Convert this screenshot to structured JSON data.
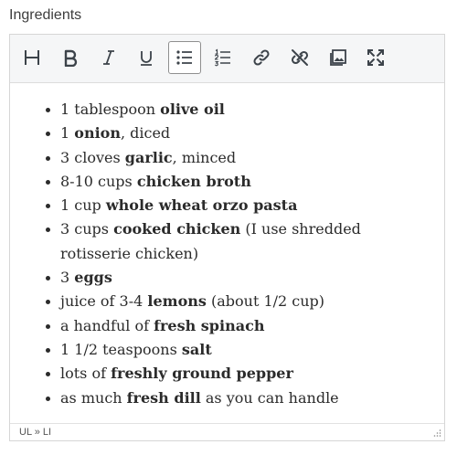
{
  "field": {
    "label": "Ingredients"
  },
  "toolbar": {
    "buttons": [
      {
        "name": "heading",
        "icon": "heading-icon",
        "active": false
      },
      {
        "name": "bold",
        "icon": "bold-icon",
        "active": false
      },
      {
        "name": "italic",
        "icon": "italic-icon",
        "active": false
      },
      {
        "name": "underline",
        "icon": "underline-icon",
        "active": false
      },
      {
        "name": "bulleted-list",
        "icon": "bulleted-list-icon",
        "active": true
      },
      {
        "name": "numbered-list",
        "icon": "numbered-list-icon",
        "active": false
      },
      {
        "name": "link",
        "icon": "link-icon",
        "active": false
      },
      {
        "name": "unlink",
        "icon": "unlink-icon",
        "active": false
      },
      {
        "name": "image",
        "icon": "image-icon",
        "active": false
      },
      {
        "name": "fullscreen",
        "icon": "fullscreen-icon",
        "active": false
      }
    ]
  },
  "ingredients": [
    {
      "pre": "1 tablespoon ",
      "bold": "olive oil",
      "post": ""
    },
    {
      "pre": "1 ",
      "bold": "onion",
      "post": ", diced"
    },
    {
      "pre": "3 cloves ",
      "bold": "garlic",
      "post": ", minced"
    },
    {
      "pre": "8-10 cups ",
      "bold": "chicken broth",
      "post": ""
    },
    {
      "pre": "1 cup ",
      "bold": "whole wheat orzo pasta",
      "post": ""
    },
    {
      "pre": "3 cups ",
      "bold": "cooked chicken",
      "post": " (I use shredded rotisserie chicken)"
    },
    {
      "pre": "3 ",
      "bold": "eggs",
      "post": ""
    },
    {
      "pre": "juice of 3-4 ",
      "bold": "lemons",
      "post": " (about 1/2 cup)"
    },
    {
      "pre": "a handful of ",
      "bold": "fresh spinach",
      "post": ""
    },
    {
      "pre": "1 1/2 teaspoons ",
      "bold": "salt",
      "post": ""
    },
    {
      "pre": "lots of ",
      "bold": "freshly ground pepper",
      "post": ""
    },
    {
      "pre": "as much ",
      "bold": "fresh dill",
      "post": " as you can handle"
    }
  ],
  "statusbar": {
    "path": "UL » LI"
  },
  "colors": {
    "toolbar_bg": "#f5f6f7",
    "border": "#d6d6d6",
    "text": "#2b2b2b",
    "icon": "#3c434a"
  }
}
